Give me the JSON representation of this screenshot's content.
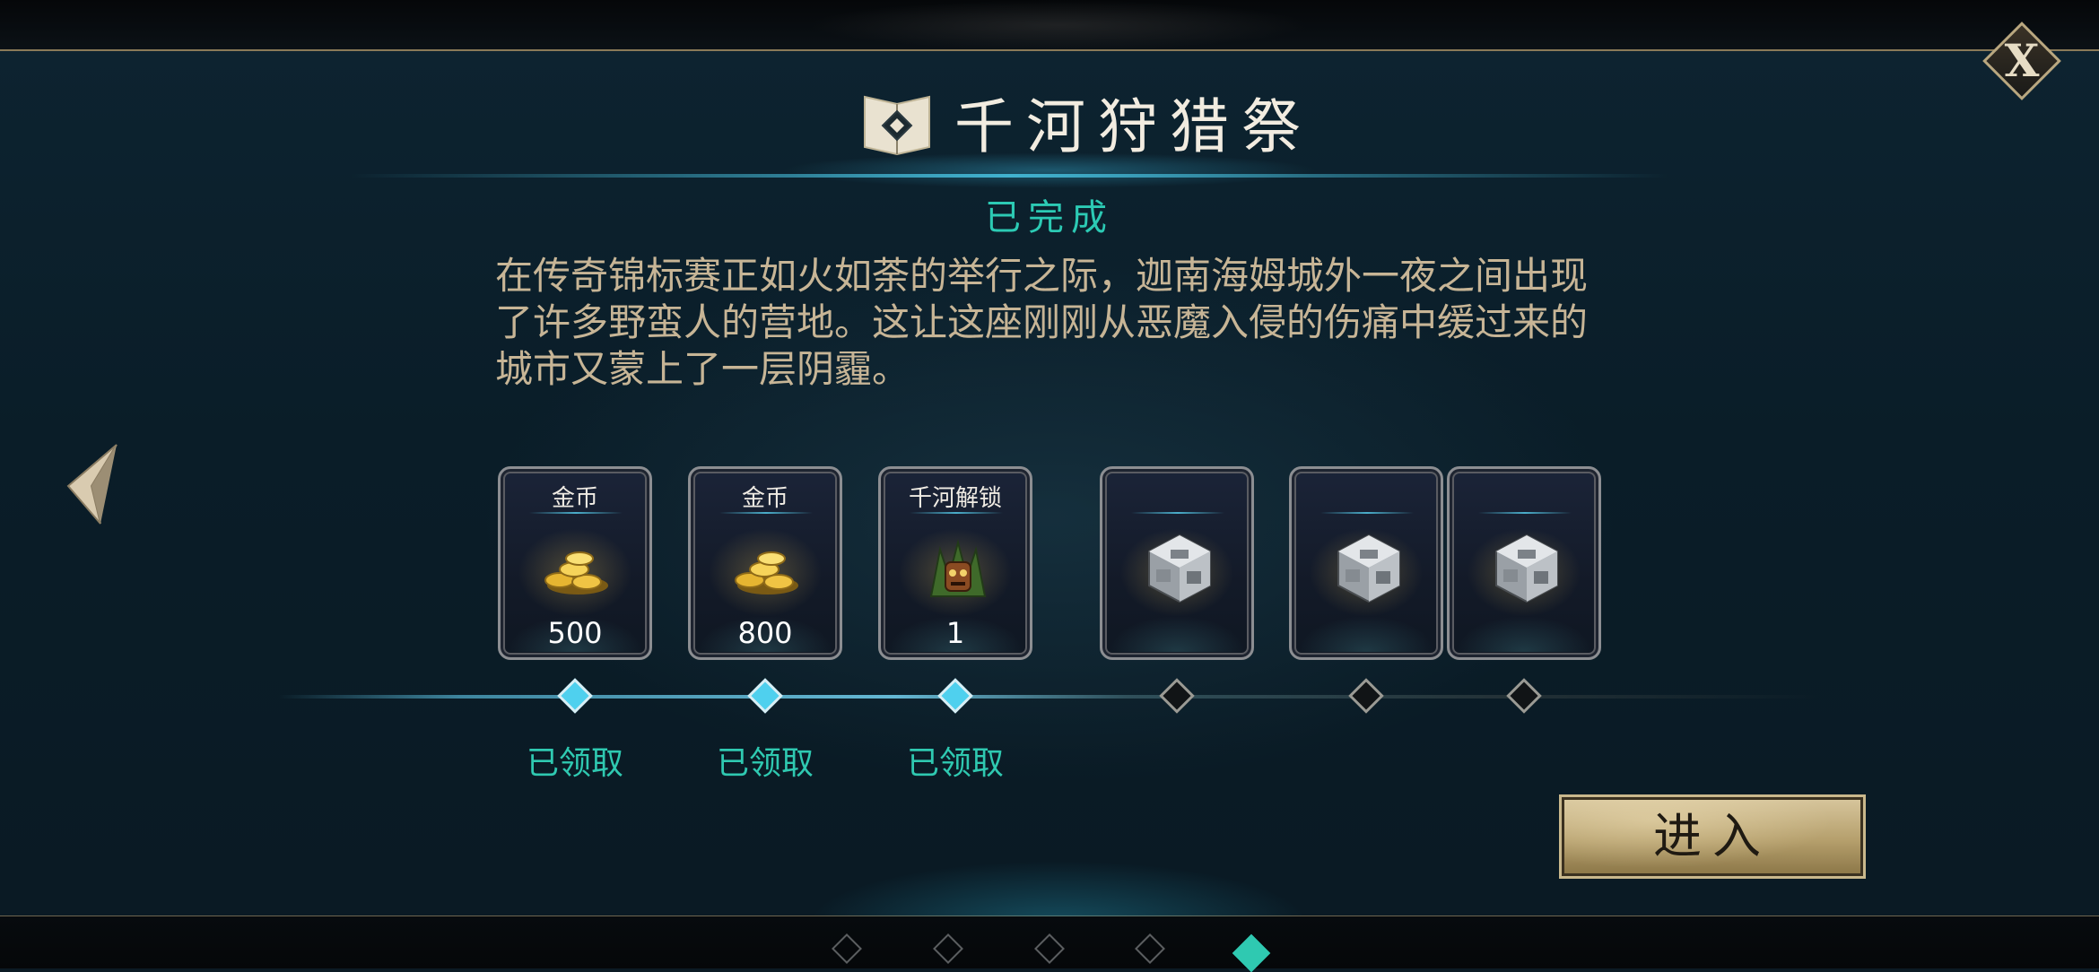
{
  "event": {
    "title": "千河狩猎祭",
    "status": "已完成",
    "description": "在传奇锦标赛正如火如荼的举行之际，迦南海姆城外一夜之间出现了许多野蛮人的营地。这让这座刚刚从恶魔入侵的伤痛中缓过来的城市又蒙上了一层阴霾。"
  },
  "close_button": {
    "label": "X"
  },
  "rewards": [
    {
      "label": "金币",
      "amount": "500",
      "icon": "gold-coins-icon",
      "claimed_text": "已领取",
      "claimed": true
    },
    {
      "label": "金币",
      "amount": "800",
      "icon": "gold-coins-icon",
      "claimed_text": "已领取",
      "claimed": true
    },
    {
      "label": "千河解锁",
      "amount": "1",
      "icon": "tribal-totem-icon",
      "claimed_text": "已领取",
      "claimed": true
    },
    {
      "label": "",
      "amount": "",
      "icon": "silver-cube-icon",
      "claimed_text": "",
      "claimed": false
    },
    {
      "label": "",
      "amount": "",
      "icon": "silver-cube-icon",
      "claimed_text": "",
      "claimed": false
    },
    {
      "label": "",
      "amount": "",
      "icon": "silver-cube-icon",
      "claimed_text": "",
      "claimed": false
    }
  ],
  "enter_button": {
    "label": "进入"
  },
  "pagination": {
    "total": 5,
    "active": 5
  },
  "colors": {
    "accent_teal": "#2fc9b1",
    "gold": "#c9b88c",
    "description_text": "#c7b596",
    "panel_bg": "#0b1a24"
  }
}
